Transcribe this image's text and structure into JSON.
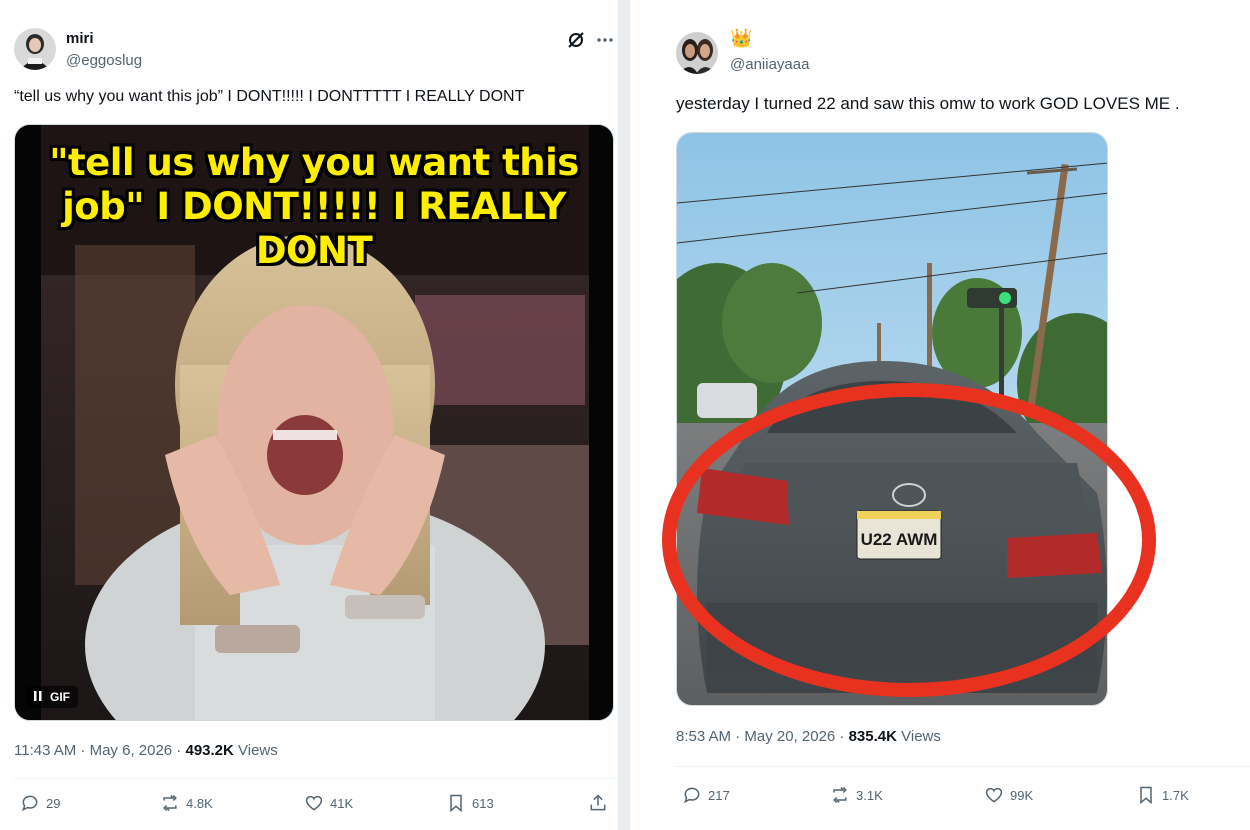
{
  "left_tweet": {
    "name": "miri",
    "handle": "@eggoslug",
    "text": "“tell us why you want this job” I DONT!!!!! I DONTTTTT I REALLY DONT",
    "media": {
      "caption_lines": [
        "\"tell us why you want this",
        "job\" I DONT!!!!! I REALLY",
        "DONT"
      ],
      "badge": "GIF"
    },
    "timestamp": "11:43 AM · May 6, 2026 · ",
    "views_count": "493.2K",
    "views_label": " Views",
    "actions": {
      "replies": "29",
      "reposts": "4.8K",
      "likes": "41K",
      "bookmarks": "613"
    },
    "icons": [
      "grok-icon",
      "more-icon",
      "reply-icon",
      "repost-icon",
      "like-icon",
      "bookmark-icon",
      "share-icon"
    ]
  },
  "right_tweet": {
    "badge_emoji": "👑",
    "handle": "@aniiayaaa",
    "text": "yesterday I turned 22 and saw this omw to work GOD LOVES ME .",
    "media": {
      "plate_text": "U22 AWM"
    },
    "timestamp": "8:53 AM · May 20, 2026 · ",
    "views_count": "835.4K",
    "views_label": " Views",
    "actions": {
      "replies": "217",
      "reposts": "3.1K",
      "likes": "99K",
      "bookmarks": "1.7K"
    },
    "icons": [
      "reply-icon",
      "repost-icon",
      "like-icon",
      "bookmark-icon"
    ]
  },
  "colors": {
    "text": "#0f1419",
    "secondary": "#536471",
    "highlight_circle": "#e8321f",
    "caption_yellow": "#ffee00"
  }
}
